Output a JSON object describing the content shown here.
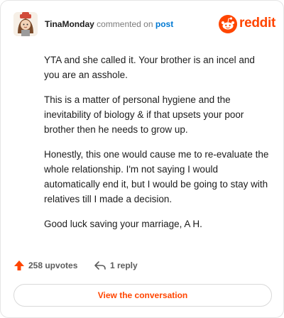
{
  "header": {
    "username": "TinaMonday",
    "verb": "commented on",
    "post_link": "post",
    "brand": "reddit"
  },
  "comment": {
    "paragraphs": [
      "YTA and she called it. Your brother is an incel and you are an asshole.",
      "This is a matter of personal hygiene and the inevitability of biology & if that upsets your poor brother then he needs to grow up.",
      "Honestly, this one would cause me to re-evaluate the whole relationship. I'm not saying I would automatically end it, but I would be going to stay with relatives till I made a decision.",
      "Good luck saving your marriage, A H."
    ]
  },
  "footer": {
    "upvotes": "258 upvotes",
    "replies": "1 reply"
  },
  "cta": {
    "label": "View the conversation"
  },
  "colors": {
    "brand": "#ff4500",
    "link": "#0079d3",
    "muted": "#7c7c7c"
  },
  "icons": [
    "avatar-icon",
    "reddit-logo-icon",
    "upvote-icon",
    "reply-icon"
  ]
}
